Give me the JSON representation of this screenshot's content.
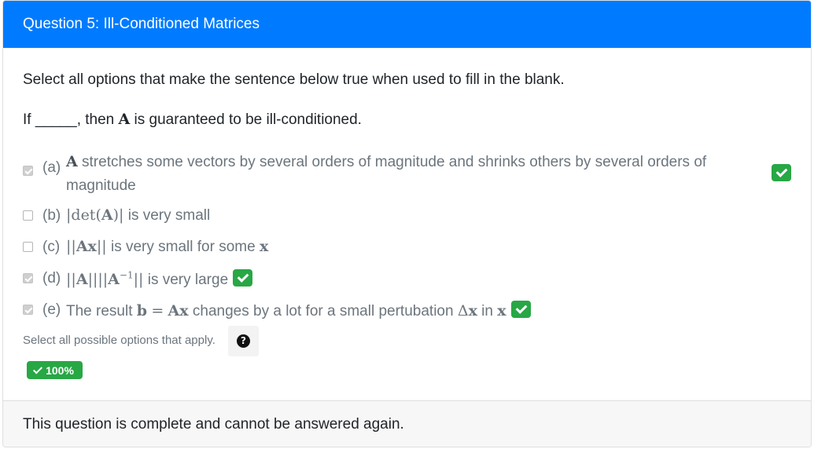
{
  "header": {
    "title": "Question 5: Ill-Conditioned Matrices"
  },
  "prompt": "Select all options that make the sentence below true when used to fill in the blank.",
  "sentence": {
    "if": "If",
    "blank": "_____",
    "comma": ",",
    "then": "then",
    "A": "A",
    "rest": "is guaranteed to be ill-conditioned."
  },
  "options": [
    {
      "letter": "(a)",
      "checked": true,
      "correct": true,
      "A": "A",
      "text1": "stretches some vectors by several orders of magnitude and shrinks others by several orders of",
      "text2": "magnitude"
    },
    {
      "letter": "(b)",
      "checked": false,
      "math_pre": "|det(",
      "math_A": "A",
      "math_post": ")|",
      "text": "is very small"
    },
    {
      "letter": "(c)",
      "checked": false,
      "math_pre": "||",
      "math_Ax": "Ax",
      "math_post": "||",
      "text": "is very small for some",
      "x": "x"
    },
    {
      "letter": "(d)",
      "checked": true,
      "correct": true,
      "m1": "||",
      "mA": "A",
      "m2": "||||",
      "mA2": "A",
      "sup": "−1",
      "m3": "||",
      "text": "is very large"
    },
    {
      "letter": "(e)",
      "checked": true,
      "correct": true,
      "t1": "The result",
      "b": "b",
      "eq": "=",
      "Ax": "Ax",
      "t2": "changes by a lot for a small pertubation",
      "delta": "Δ",
      "x": "x",
      "in": "in",
      "x2": "x"
    }
  ],
  "help_text": "Select all possible options that apply.",
  "help_icon": "question-circle-icon",
  "score": "100%",
  "footer": "This question is complete and cannot be answered again.",
  "colors": {
    "header": "#007bff",
    "success": "#28a745",
    "muted": "#6c757d"
  }
}
